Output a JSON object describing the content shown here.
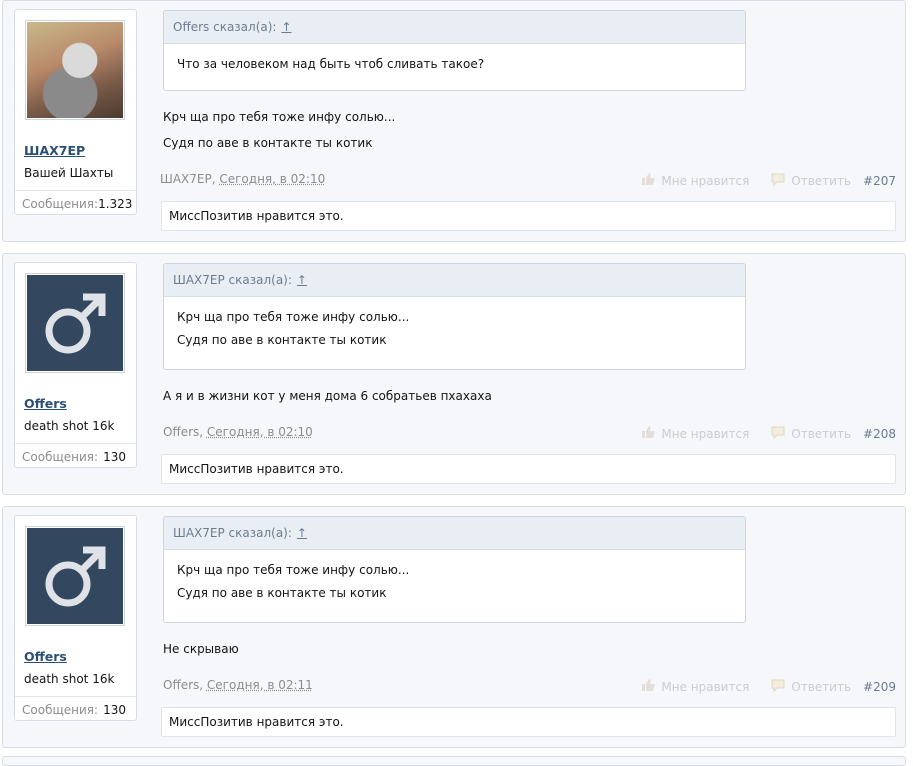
{
  "posts": [
    {
      "author": "ШАХ7ЕР",
      "user_title": "Вашей Шахты",
      "messages_label": "Сообщения:",
      "messages_count": "1.323",
      "avatar": "bird-photo",
      "quote_header": "Offers сказал(а):",
      "quote_arrow": "↑",
      "quote_lines": [
        "Что за человеком над быть чтоб сливать такое?"
      ],
      "message_lines": [
        "Крч ща про тебя тоже инфу солью...",
        "Судя по аве в контакте ты котик"
      ],
      "meta_author": "ШАХ7ЕР",
      "meta_date": "Сегодня, в 02:10",
      "like_label": "Мне нравится",
      "reply_label": "Ответить",
      "post_number": "#207",
      "likes_text": "МиссПозитив нравится это."
    },
    {
      "author": "Offers",
      "user_title": "death shot 16k",
      "messages_label": "Сообщения:",
      "messages_count": "130",
      "avatar": "male-default",
      "quote_header": "ШАХ7ЕР сказал(а):",
      "quote_arrow": "↑",
      "quote_lines": [
        "Крч ща про тебя тоже инфу солью...",
        "Судя по аве в контакте ты котик"
      ],
      "message_lines": [
        "А я и в жизни кот у меня дома 6 собратьев пхахаха"
      ],
      "meta_author": "Offers",
      "meta_date": "Сегодня, в 02:10",
      "like_label": "Мне нравится",
      "reply_label": "Ответить",
      "post_number": "#208",
      "likes_text": "МиссПозитив нравится это."
    },
    {
      "author": "Offers",
      "user_title": "death shot 16k",
      "messages_label": "Сообщения:",
      "messages_count": "130",
      "avatar": "male-default",
      "quote_header": "ШАХ7ЕР сказал(а):",
      "quote_arrow": "↑",
      "quote_lines": [
        "Крч ща про тебя тоже инфу солью...",
        "Судя по аве в контакте ты котик"
      ],
      "message_lines": [
        "Не скрываю"
      ],
      "meta_author": "Offers",
      "meta_date": "Сегодня, в 02:11",
      "like_label": "Мне нравится",
      "reply_label": "Ответить",
      "post_number": "#209",
      "likes_text": "МиссПозитив нравится это."
    }
  ],
  "colors": {
    "username": "#2b4f76",
    "avatar_default_bg": "#33475e",
    "muted": "#8c8c8c",
    "actions": "#c9ccd1"
  }
}
